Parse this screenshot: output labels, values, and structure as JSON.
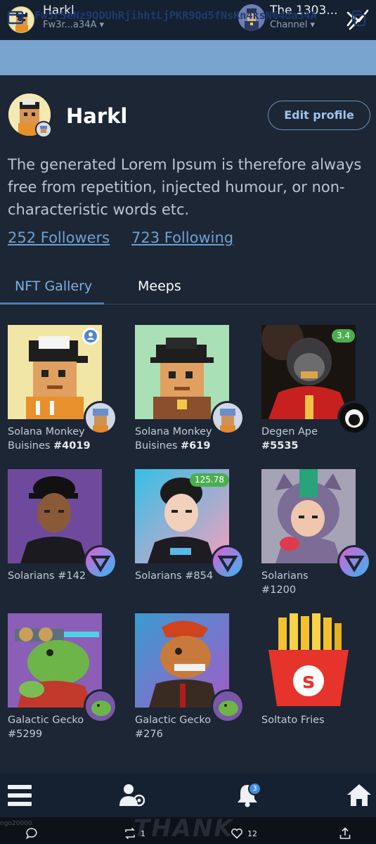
{
  "topbar": {
    "user_name": "Harkl",
    "wallet_short": "Fw3r...a34A ▾",
    "channel_name": "The 1303...",
    "channel_sub": "Channel ▾"
  },
  "address": {
    "full": "Fw3rSeNz9QDUhRjihhtLjPKR9Qd5fNsKn4ksN64da34A"
  },
  "profile": {
    "name": "Harkl",
    "edit_label": "Edit profile",
    "bio": "The generated Lorem Ipsum is therefore always free from repetition, injected humour, or non-characteristic words etc.",
    "followers": "252 Followers",
    "following": "723 Following"
  },
  "tabs": {
    "nft": "NFT Gallery",
    "meeps": "Meeps"
  },
  "nfts": [
    {
      "line1": "Solana Monkey",
      "line2_prefix": "Buisines ",
      "line2_num": "#4019"
    },
    {
      "line1": "Solana Monkey",
      "line2_prefix": "Buisines ",
      "line2_num": "#619"
    },
    {
      "line1": "Degen Ape",
      "line2_prefix": "",
      "line2_num": "#5535",
      "price": "3.4"
    },
    {
      "line1": "Solarians #142",
      "line2_prefix": "",
      "line2_num": ""
    },
    {
      "line1": "Solarians #854",
      "line2_prefix": "",
      "line2_num": "",
      "price": "125.78"
    },
    {
      "line1": "Solarians",
      "line2_prefix": "#1200",
      "line2_num": ""
    },
    {
      "line1": "Galactic Gecko",
      "line2_prefix": "#5299",
      "line2_num": ""
    },
    {
      "line1": "Galactic Gecko",
      "line2_prefix": "#276",
      "line2_num": ""
    },
    {
      "line1": "Soltato Fries",
      "line2_prefix": "",
      "line2_num": ""
    }
  ],
  "bottomnav": {
    "notification_count": "3"
  },
  "sysbar": {
    "retweets": "1",
    "likes": "12",
    "bg_small": "ngo20000",
    "bg_large": "THANK"
  },
  "colors": {
    "background": "#1c2634",
    "topbar": "#152030",
    "address_bar": "#7aa4d0",
    "link": "#6f9fd1",
    "price_badge": "#4cae4f",
    "active_tab": "#7fb0e4"
  },
  "icons": {
    "chart": "chart-trend-icon",
    "wallet": "wallet-icon",
    "copy": "copy-icon",
    "menu": "menu-icon",
    "people": "people-icon",
    "bell": "bell-icon",
    "home": "home-icon"
  }
}
